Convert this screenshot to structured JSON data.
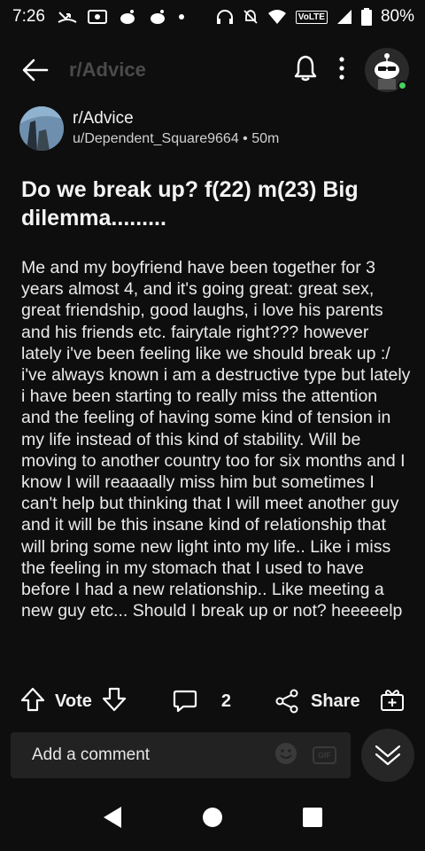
{
  "status_bar": {
    "time": "7:26",
    "battery": "80%",
    "network": "VoLTE"
  },
  "top_bar": {
    "subreddit": "r/Advice"
  },
  "post": {
    "subreddit": "r/Advice",
    "author": "u/Dependent_Square9664",
    "age": "50m",
    "title": "Do we break up? f(22) m(23) Big dilemma.........",
    "body": "Me and my boyfriend have been together for 3 years almost 4, and it's going great: great sex, great friendship, good laughs, i love his parents and his friends etc. fairytale right??? however lately i've been feeling like we should break up :/  i've always known i am a destructive type but lately i have been starting to really miss the attention and the feeling of having some kind of tension in my life instead of this kind of stability. Will be moving to another country too for six months and I know I will reaaaally miss him but sometimes I can't help but thinking that I will meet another guy and it will be this insane kind of relationship that will bring some new light into my life.. Like i miss the feeling in my stomach that I used to have before I had a new relationship.. Like meeting a new guy etc... Should I break up or not? heeeeelp"
  },
  "actions": {
    "vote_label": "Vote",
    "comment_count": "2",
    "share_label": "Share"
  },
  "comment_box": {
    "placeholder": "Add a comment",
    "gif_label": "GIF"
  },
  "colors": {
    "background": "#0e0e0e",
    "online": "#46d160"
  }
}
